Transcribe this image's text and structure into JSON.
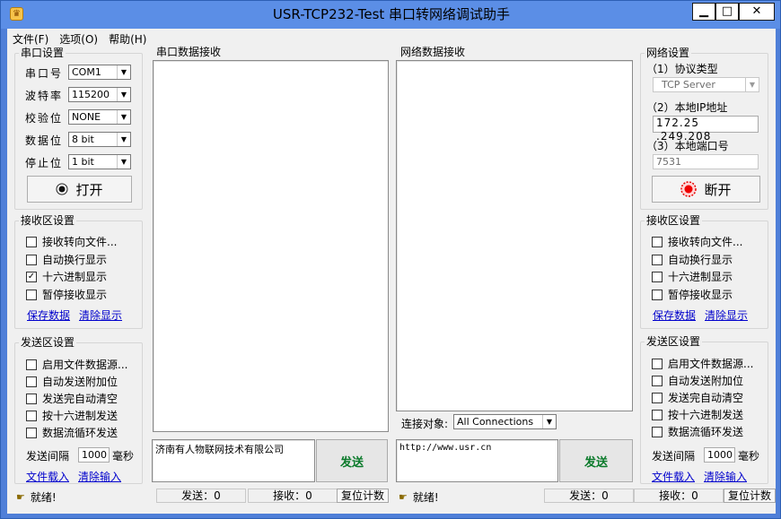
{
  "window": {
    "title": "USR-TCP232-Test 串口转网络调试助手",
    "min": "▁",
    "max": "□",
    "close": "✕"
  },
  "menu": [
    "文件(F)",
    "选项(O)",
    "帮助(H)"
  ],
  "serial": {
    "group_title": "串口设置",
    "port_label": "串口号",
    "port_value": "COM1",
    "baud_label": "波特率",
    "baud_value": "115200",
    "parity_label": "校验位",
    "parity_value": "NONE",
    "data_label": "数据位",
    "data_value": "8 bit",
    "stop_label": "停止位",
    "stop_value": "1 bit",
    "open_button": "打开"
  },
  "recv_left": {
    "group_title": "接收区设置",
    "options": [
      {
        "label": "接收转向文件...",
        "checked": false
      },
      {
        "label": "自动换行显示",
        "checked": false
      },
      {
        "label": "十六进制显示",
        "checked": true
      },
      {
        "label": "暂停接收显示",
        "checked": false
      }
    ],
    "save_link": "保存数据",
    "clear_link": "清除显示"
  },
  "send_left": {
    "group_title": "发送区设置",
    "options": [
      {
        "label": "启用文件数据源...",
        "checked": false
      },
      {
        "label": "自动发送附加位",
        "checked": false
      },
      {
        "label": "发送完自动清空",
        "checked": false
      },
      {
        "label": "按十六进制发送",
        "checked": false
      },
      {
        "label": "数据流循环发送",
        "checked": false
      }
    ],
    "interval_label": "发送间隔",
    "interval_value": "1000",
    "interval_unit": "毫秒",
    "load_link": "文件载入",
    "clear_link": "清除输入"
  },
  "serial_recv": {
    "group_title": "串口数据接收"
  },
  "net_recv": {
    "group_title": "网络数据接收"
  },
  "serial_send": {
    "text": "济南有人物联网技术有限公司",
    "send_button": "发送"
  },
  "net_send": {
    "text": "http://www.usr.cn",
    "send_button": "发送",
    "target_label": "连接对象:",
    "target_value": "All Connections"
  },
  "network": {
    "group_title": "网络设置",
    "protocol_label": "（1）协议类型",
    "protocol_value": "TCP Server",
    "ip_label": "（2）本地IP地址",
    "ip_value": "172.25 .249.208",
    "port_label": "（3）本地端口号",
    "port_value": "7531",
    "disconnect_button": "断开"
  },
  "recv_right": {
    "group_title": "接收区设置",
    "options": [
      {
        "label": "接收转向文件...",
        "checked": false
      },
      {
        "label": "自动换行显示",
        "checked": false
      },
      {
        "label": "十六进制显示",
        "checked": false
      },
      {
        "label": "暂停接收显示",
        "checked": false
      }
    ],
    "save_link": "保存数据",
    "clear_link": "清除显示"
  },
  "send_right": {
    "group_title": "发送区设置",
    "options": [
      {
        "label": "启用文件数据源...",
        "checked": false
      },
      {
        "label": "自动发送附加位",
        "checked": false
      },
      {
        "label": "发送完自动清空",
        "checked": false
      },
      {
        "label": "按十六进制发送",
        "checked": false
      },
      {
        "label": "数据流循环发送",
        "checked": false
      }
    ],
    "interval_label": "发送间隔",
    "interval_value": "1000",
    "interval_unit": "毫秒",
    "load_link": "文件载入",
    "clear_link": "清除输入"
  },
  "status_left": {
    "text": "就绪!",
    "send": "发送：0",
    "recv": "接收：0",
    "reset": "复位计数"
  },
  "status_right": {
    "text": "就绪!",
    "send": "发送：0",
    "recv": "接收：0",
    "reset": "复位计数"
  }
}
